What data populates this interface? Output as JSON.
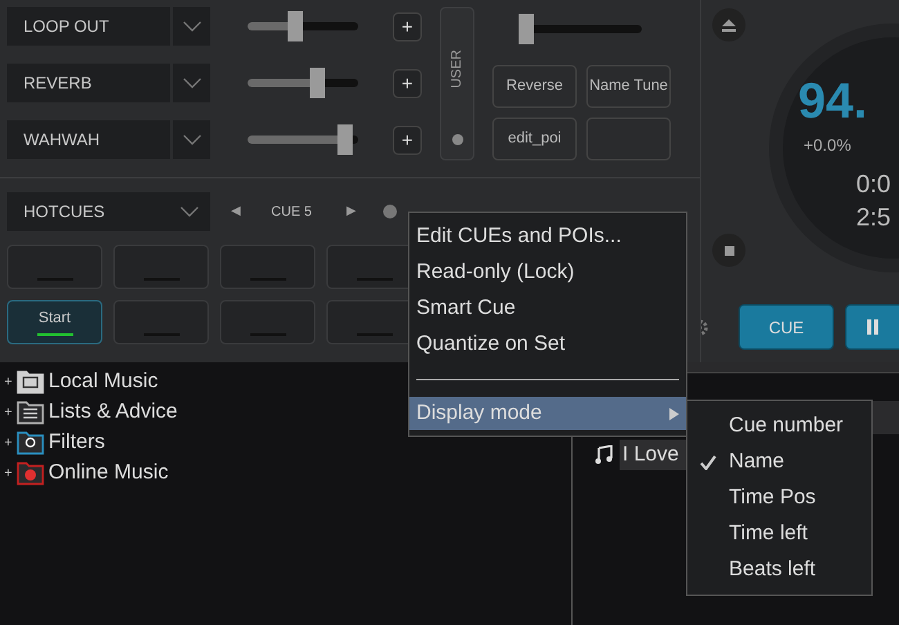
{
  "effects": [
    {
      "name": "LOOP OUT",
      "level": 0.42
    },
    {
      "name": "REVERB",
      "level": 0.62
    },
    {
      "name": "WAHWAH",
      "level": 0.88
    }
  ],
  "plus_label": "+",
  "user_panel": {
    "label": "USER"
  },
  "master_slider": {
    "level": 0.05
  },
  "pad_buttons": [
    {
      "kind": "text",
      "label": "Reverse"
    },
    {
      "kind": "text",
      "label": "Name Tune"
    },
    {
      "kind": "text",
      "label": "edit_poi"
    },
    {
      "kind": "blank"
    }
  ],
  "hotcues": {
    "name": "HOTCUES",
    "prev": "◀",
    "cue": "CUE 5",
    "next": "▶",
    "pads": [
      {
        "active": false
      },
      {
        "active": false
      },
      {
        "active": false
      },
      {
        "active": false
      },
      {
        "label": "Start",
        "active": true
      },
      {
        "active": false
      },
      {
        "active": false
      },
      {
        "active": false
      }
    ]
  },
  "deck": {
    "bpm": "94.",
    "pitch": "+0.0%",
    "time_elapsed": "0:0",
    "time_left": "2:5",
    "cue_button": "CUE"
  },
  "browser": {
    "tree": [
      {
        "label": "Local Music",
        "kind": "computer",
        "color": "#d0d0d0"
      },
      {
        "label": "Lists & Advice",
        "kind": "list",
        "color": "#b0b0b0"
      },
      {
        "label": "Filters",
        "kind": "filter",
        "color": "#2a8fc0"
      },
      {
        "label": "Online Music",
        "kind": "online",
        "color": "#c42020"
      }
    ],
    "expand_label": "+",
    "track": "I Love"
  },
  "context_menu": [
    {
      "kind": "item",
      "label": "Edit CUEs and POIs..."
    },
    {
      "kind": "item",
      "label": "Read-only (Lock)"
    },
    {
      "kind": "item",
      "label": "Smart Cue"
    },
    {
      "kind": "item",
      "label": "Quantize on Set"
    },
    {
      "kind": "separator"
    },
    {
      "kind": "submenu",
      "label": "Display mode",
      "selected": true
    }
  ],
  "submenu": [
    {
      "label": "Cue number",
      "checked": false
    },
    {
      "label": "Name",
      "checked": true
    },
    {
      "label": "Time Pos",
      "checked": false
    },
    {
      "label": "Time left",
      "checked": false
    },
    {
      "label": "Beats left",
      "checked": false
    }
  ]
}
